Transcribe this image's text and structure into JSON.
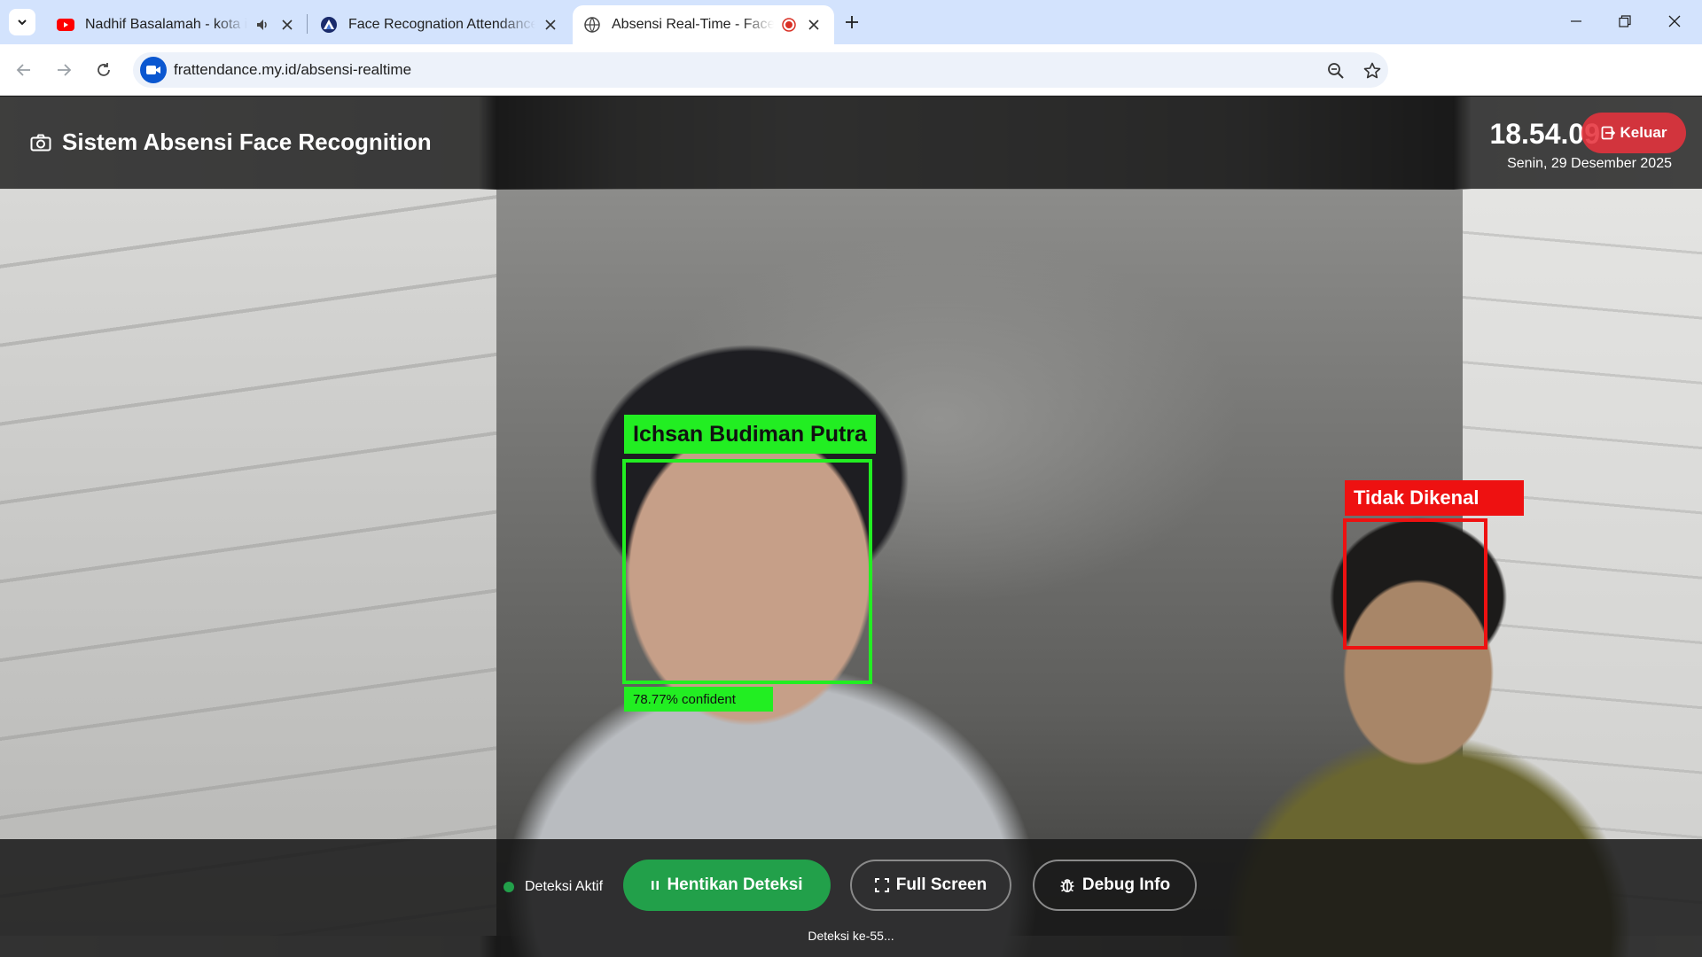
{
  "browser": {
    "tabs": [
      {
        "title": "Nadhif Basalamah - kota ini",
        "favicon": "youtube-icon",
        "audio": true
      },
      {
        "title": "Face Recognation Attendance |",
        "favicon": "site-logo-icon"
      },
      {
        "title": "Absensi Real-Time - Face Recognition",
        "favicon": "globe-icon",
        "recording": true,
        "active": true
      }
    ],
    "url": "frattendance.my.id/absensi-realtime"
  },
  "app": {
    "title": "Sistem Absensi Face Recognition",
    "clock": "18.54.09",
    "date": "Senin, 29 Desember 2025",
    "logout_label": "Keluar",
    "colors": {
      "known": "#22ee22",
      "unknown": "#ee1111",
      "active": "#22a04a",
      "logout": "#e6323c"
    }
  },
  "detections": [
    {
      "name": "Ichsan Budiman Putra",
      "status": "known",
      "confidence_label": "78.77% confident"
    },
    {
      "name": "Tidak Dikenal",
      "status": "unknown"
    }
  ],
  "controls": {
    "status_label": "Deteksi Aktif",
    "stop_label": "Hentikan Deteksi",
    "fullscreen_label": "Full Screen",
    "debug_label": "Debug Info",
    "detection_count": "Deteksi ke-55..."
  }
}
